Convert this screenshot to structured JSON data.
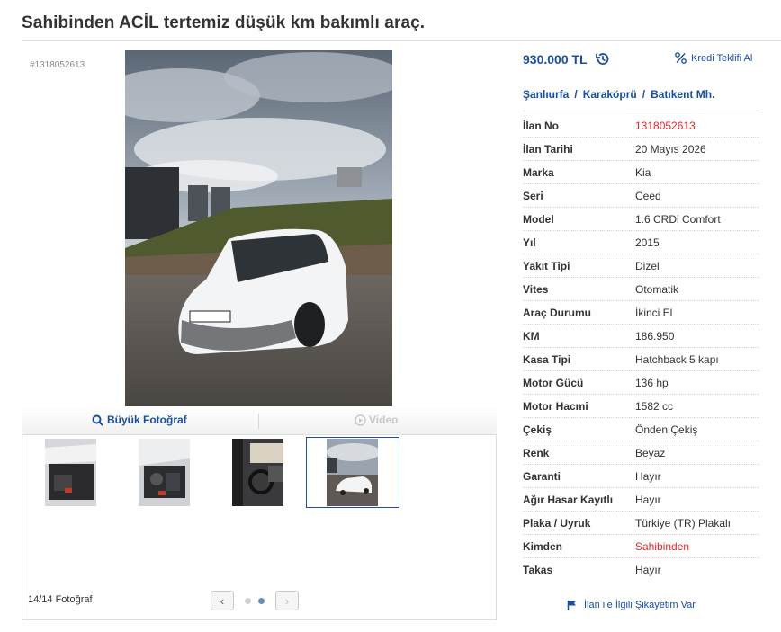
{
  "title": "Sahibinden ACİL tertemiz düşük km bakımlı araç.",
  "listing_code": "#1318052613",
  "photo_bar": {
    "big_photo_label": "Büyük Fotoğraf",
    "video_label": "Video"
  },
  "thumbnails": {
    "count_label": "14/14 Fotoğraf",
    "items": [
      "trunk-photo",
      "engine-photo",
      "interior-photo",
      "exterior-photo"
    ]
  },
  "price": "930.000 TL",
  "credit_link": "Kredi Teklifi Al",
  "location": {
    "city": "Şanlıurfa",
    "district": "Karaköprü",
    "neighborhood": "Batıkent Mh.",
    "separator": "/"
  },
  "info": [
    {
      "key": "İlan No",
      "value": "1318052613",
      "highlight": true
    },
    {
      "key": "İlan Tarihi",
      "value": "20 Mayıs 2026"
    },
    {
      "key": "Marka",
      "value": "Kia"
    },
    {
      "key": "Seri",
      "value": "Ceed"
    },
    {
      "key": "Model",
      "value": "1.6 CRDi Comfort"
    },
    {
      "key": "Yıl",
      "value": "2015"
    },
    {
      "key": "Yakıt Tipi",
      "value": "Dizel"
    },
    {
      "key": "Vites",
      "value": "Otomatik"
    },
    {
      "key": "Araç Durumu",
      "value": "İkinci El"
    },
    {
      "key": "KM",
      "value": "186.950"
    },
    {
      "key": "Kasa Tipi",
      "value": "Hatchback 5 kapı"
    },
    {
      "key": "Motor Gücü",
      "value": "136 hp"
    },
    {
      "key": "Motor Hacmi",
      "value": "1582 cc"
    },
    {
      "key": "Çekiş",
      "value": "Önden Çekiş"
    },
    {
      "key": "Renk",
      "value": "Beyaz"
    },
    {
      "key": "Garanti",
      "value": "Hayır"
    },
    {
      "key": "Ağır Hasar Kayıtlı",
      "value": "Hayır"
    },
    {
      "key": "Plaka / Uyruk",
      "value": "Türkiye (TR) Plakalı"
    },
    {
      "key": "Kimden",
      "value": "Sahibinden",
      "highlight": true
    },
    {
      "key": "Takas",
      "value": "Hayır"
    }
  ],
  "complaint_link": "İlan ile İlgili Şikayetim Var",
  "colors": {
    "link_blue": "#1a4fa0",
    "highlight_red": "#e02828",
    "text": "#333333",
    "border": "#dcdcdc"
  }
}
